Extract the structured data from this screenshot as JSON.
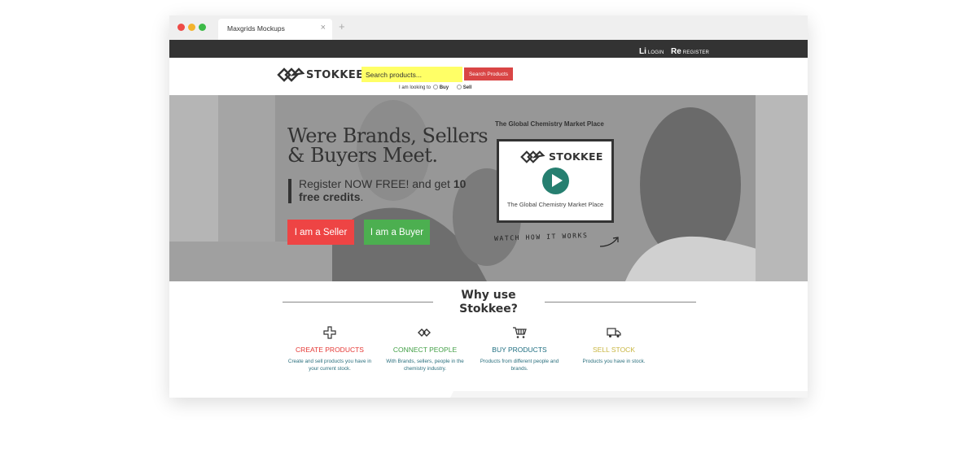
{
  "browser": {
    "tab_title": "Maxgrids Mockups",
    "tab_close": "×",
    "new_tab": "+"
  },
  "topbar": {
    "login_abbr": "Li",
    "login_label": "LOGIN",
    "register_abbr": "Re",
    "register_label": "REGISTER"
  },
  "header": {
    "logo_text": "STOKKEE",
    "search_placeholder": "Search products...",
    "search_button": "Search Products",
    "looking_label": "I am looking to",
    "option_buy": "Buy",
    "option_sell": "Sell"
  },
  "hero": {
    "title": "Were Brands, Sellers & Buyers Meet.",
    "subtitle_pre": "Register NOW FREE! and get ",
    "subtitle_bold": "10 free credits",
    "subtitle_post": ".",
    "seller_button": "I am a Seller",
    "buyer_button": "I am a Buyer",
    "market_title": "The Global Chemistry Market Place",
    "video_logo": "STOKKEE",
    "video_caption": "The Global Chemistry Market Place",
    "watch_label": "WATCH HOW IT WORKS"
  },
  "why": {
    "title": "Why use Stokkee?",
    "features": [
      {
        "icon": "plus-icon",
        "name": "CREATE PRODUCTS",
        "desc": "Create and sell products you have in your current stock.",
        "color": "#e53935"
      },
      {
        "icon": "connect-icon",
        "name": "CONNECT PEOPLE",
        "desc": "With Brands, sellers, people in the chemistry industry.",
        "color": "#43a047"
      },
      {
        "icon": "cart-icon",
        "name": "BUY PRODUCTS",
        "desc": "Products from different people and brands.",
        "color": "#1e6e80"
      },
      {
        "icon": "truck-icon",
        "name": "SELL STOCK",
        "desc": "Products you have in stock.",
        "color": "#c9b642"
      }
    ]
  },
  "colors": {
    "accent_yellow": "#ffff66",
    "search_red": "#d94545",
    "seller_red": "#ee4444",
    "buyer_green": "#4caf50",
    "play_teal": "#267f70",
    "topbar": "#333333"
  }
}
